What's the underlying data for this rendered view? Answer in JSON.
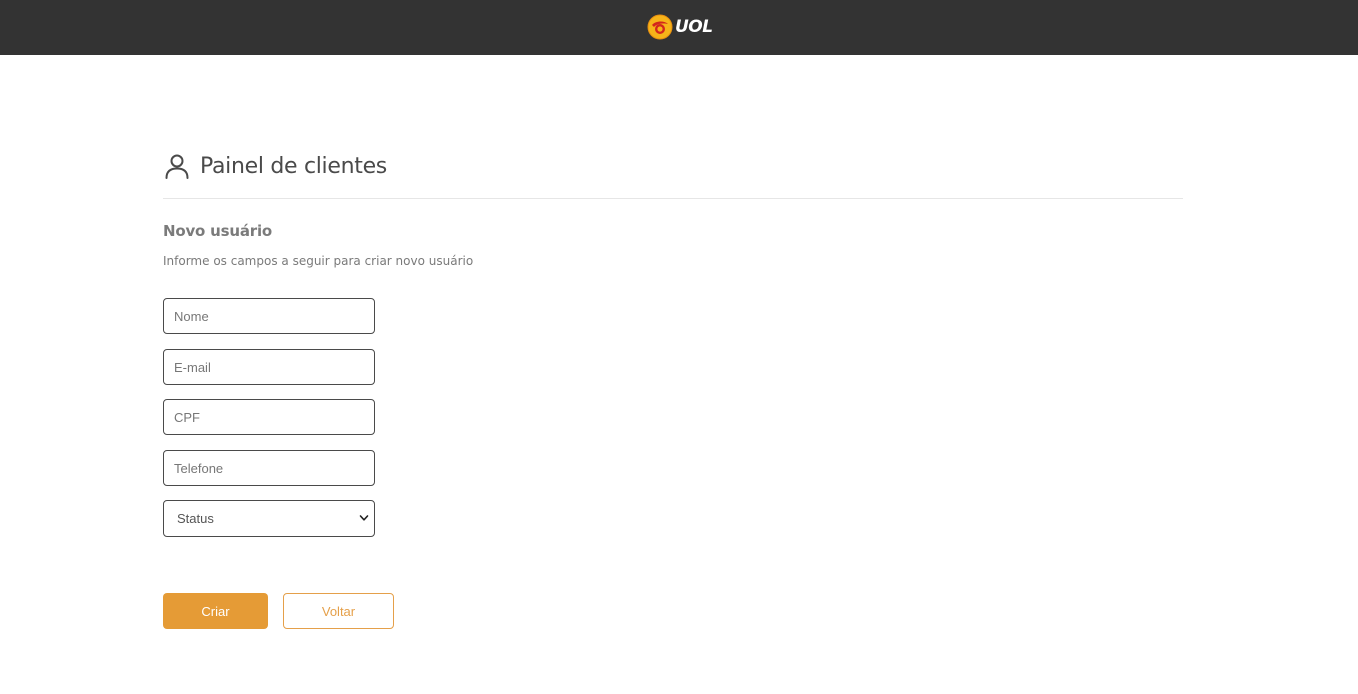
{
  "header": {
    "brand": "UOL",
    "brand_colors": {
      "bar": "#333333",
      "logo_yellow": "#f6b319",
      "logo_red": "#d3261c"
    }
  },
  "panel": {
    "title": "Painel de clientes",
    "title_icon": "user-icon"
  },
  "form": {
    "section_title": "Novo usuário",
    "description": "Informe os campos a seguir para criar novo usuário",
    "fields": {
      "nome": {
        "placeholder": "Nome",
        "value": ""
      },
      "email": {
        "placeholder": "E-mail",
        "value": ""
      },
      "cpf": {
        "placeholder": "CPF",
        "value": ""
      },
      "telefone": {
        "placeholder": "Telefone",
        "value": ""
      }
    },
    "status": {
      "selected": "Status"
    }
  },
  "actions": {
    "create_label": "Criar",
    "back_label": "Voltar",
    "accent": "#e59b36"
  }
}
